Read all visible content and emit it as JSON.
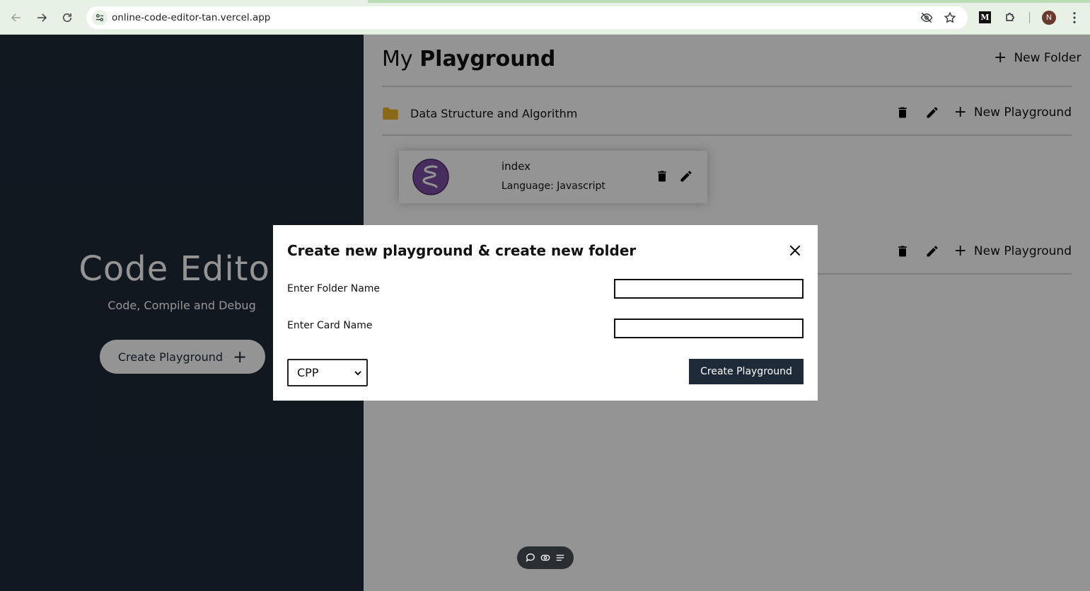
{
  "browser": {
    "url": "online-code-editor-tan.vercel.app",
    "profile_initial": "N",
    "extension_label": "M"
  },
  "hero": {
    "title": "Code Editor",
    "subtitle": "Code, Compile and Debug",
    "create_button": "Create Playground",
    "plus": "+"
  },
  "playground": {
    "heading_light": "My",
    "heading_bold": "Playground",
    "new_folder_label": "New Folder",
    "plus": "+",
    "folders": [
      {
        "name": "Data Structure and Algorithm",
        "new_playground_label": "New Playground",
        "cards": [
          {
            "title": "index",
            "language": "Language: Javascript"
          }
        ]
      },
      {
        "name": "",
        "new_playground_label": "New Playground"
      }
    ]
  },
  "modal": {
    "title": "Create new playground & create new folder",
    "folder_label": "Enter Folder Name",
    "folder_value": "",
    "card_label": "Enter Card Name",
    "card_value": "",
    "language_selected": "CPP",
    "create_button": "Create Playground"
  },
  "colors": {
    "sidebar_bg": "#1e2a38",
    "folder_icon": "#f0b429",
    "primary_button": "#1e2a38"
  },
  "icons": {
    "back": "arrow-left-icon",
    "forward": "arrow-right-icon",
    "reload": "reload-icon",
    "site_info": "tune-icon",
    "eye_off": "eye-off-icon",
    "star": "star-icon",
    "puzzle": "puzzle-icon",
    "menu": "kebab-menu-icon",
    "folder": "folder-icon",
    "trash": "trash-icon",
    "edit": "pencil-icon",
    "close": "close-icon"
  }
}
